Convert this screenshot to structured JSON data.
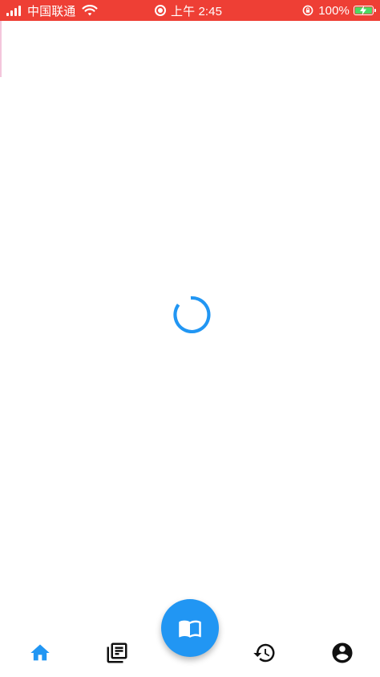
{
  "status_bar": {
    "carrier": "中国联通",
    "time": "上午 2:45",
    "battery_percent": "100%",
    "battery_level": 1.0,
    "background_color": "#ee3f35",
    "icons": [
      "signal-icon",
      "wifi-icon",
      "screen-record-icon",
      "rotation-lock-icon",
      "battery-charging-icon"
    ]
  },
  "main": {
    "loading": true,
    "spinner_color": "#2196f3"
  },
  "bottom_nav": {
    "items": [
      {
        "name": "home",
        "icon": "home-icon",
        "active": true
      },
      {
        "name": "library",
        "icon": "library-books-icon",
        "active": false
      },
      {
        "name": "read",
        "icon": "open-book-icon",
        "active": false
      },
      {
        "name": "history",
        "icon": "history-icon",
        "active": false
      },
      {
        "name": "account",
        "icon": "account-circle-icon",
        "active": false
      }
    ],
    "active_color": "#2196f3",
    "inactive_color": "#111111",
    "fab_color": "#2196f3"
  }
}
